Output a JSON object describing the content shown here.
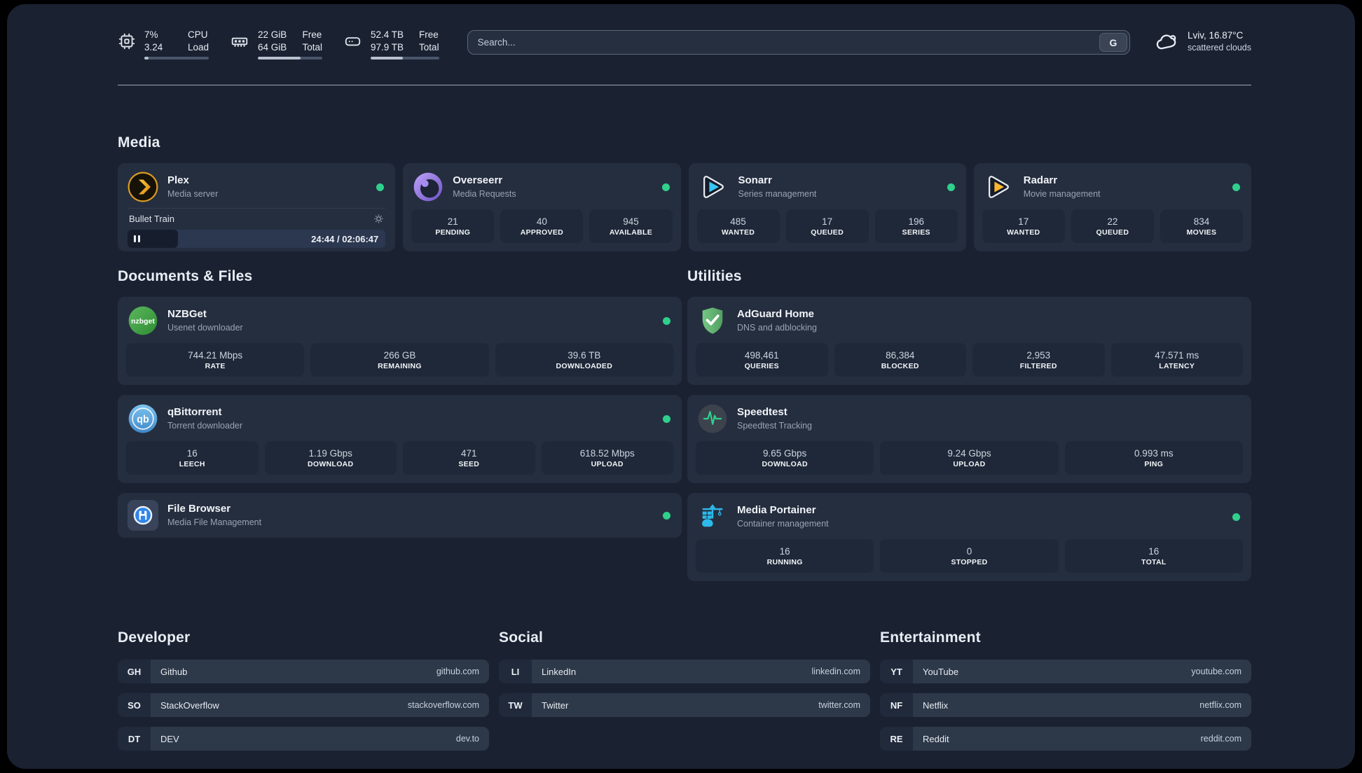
{
  "header": {
    "metrics": [
      {
        "name": "cpu",
        "line1": "7%",
        "line2": "3.24",
        "label1": "CPU",
        "label2": "Load",
        "progress": 7
      },
      {
        "name": "memory",
        "line1": "22 GiB",
        "line2": "64 GiB",
        "label1": "Free",
        "label2": "Total",
        "progress": 66
      },
      {
        "name": "storage",
        "line1": "52.4 TB",
        "line2": "97.9 TB",
        "label1": "Free",
        "label2": "Total",
        "progress": 47
      }
    ],
    "search": {
      "placeholder": "Search...",
      "provider_button": "G"
    },
    "weather": {
      "headline": "Lviv, 16.87°C",
      "condition": "scattered clouds"
    }
  },
  "sections": {
    "media": "Media",
    "documents": "Documents & Files",
    "utilities": "Utilities"
  },
  "apps": {
    "plex": {
      "name": "Plex",
      "desc": "Media server",
      "online": true,
      "player": {
        "title": "Bullet Train",
        "time": "24:44 / 02:06:47",
        "progress_pct": 19.5
      }
    },
    "overseerr": {
      "name": "Overseerr",
      "desc": "Media Requests",
      "online": true,
      "stats": [
        {
          "value": "21",
          "label": "PENDING"
        },
        {
          "value": "40",
          "label": "APPROVED"
        },
        {
          "value": "945",
          "label": "AVAILABLE"
        }
      ]
    },
    "sonarr": {
      "name": "Sonarr",
      "desc": "Series management",
      "online": true,
      "stats": [
        {
          "value": "485",
          "label": "WANTED"
        },
        {
          "value": "17",
          "label": "QUEUED"
        },
        {
          "value": "196",
          "label": "SERIES"
        }
      ]
    },
    "radarr": {
      "name": "Radarr",
      "desc": "Movie management",
      "online": true,
      "stats": [
        {
          "value": "17",
          "label": "WANTED"
        },
        {
          "value": "22",
          "label": "QUEUED"
        },
        {
          "value": "834",
          "label": "MOVIES"
        }
      ]
    },
    "nzbget": {
      "name": "NZBGet",
      "desc": "Usenet downloader",
      "online": true,
      "stats": [
        {
          "value": "744.21 Mbps",
          "label": "RATE"
        },
        {
          "value": "266 GB",
          "label": "REMAINING"
        },
        {
          "value": "39.6 TB",
          "label": "DOWNLOADED"
        }
      ]
    },
    "qbittorrent": {
      "name": "qBittorrent",
      "desc": "Torrent downloader",
      "online": true,
      "stats": [
        {
          "value": "16",
          "label": "LEECH"
        },
        {
          "value": "1.19 Gbps",
          "label": "DOWNLOAD"
        },
        {
          "value": "471",
          "label": "SEED"
        },
        {
          "value": "618.52 Mbps",
          "label": "UPLOAD"
        }
      ]
    },
    "filebrowser": {
      "name": "File Browser",
      "desc": "Media File Management",
      "online": true
    },
    "adguard": {
      "name": "AdGuard Home",
      "desc": "DNS and adblocking",
      "online": false,
      "stats": [
        {
          "value": "498,461",
          "label": "QUERIES"
        },
        {
          "value": "86,384",
          "label": "BLOCKED"
        },
        {
          "value": "2,953",
          "label": "FILTERED"
        },
        {
          "value": "47.571 ms",
          "label": "LATENCY"
        }
      ]
    },
    "speedtest": {
      "name": "Speedtest",
      "desc": "Speedtest Tracking",
      "online": false,
      "stats": [
        {
          "value": "9.65 Gbps",
          "label": "DOWNLOAD"
        },
        {
          "value": "9.24 Gbps",
          "label": "UPLOAD"
        },
        {
          "value": "0.993 ms",
          "label": "PING"
        }
      ]
    },
    "portainer": {
      "name": "Media Portainer",
      "desc": "Container management",
      "online": true,
      "stats": [
        {
          "value": "16",
          "label": "RUNNING"
        },
        {
          "value": "0",
          "label": "STOPPED"
        },
        {
          "value": "16",
          "label": "TOTAL"
        }
      ]
    }
  },
  "bookmarks": [
    {
      "title": "Developer",
      "items": [
        {
          "abbr": "GH",
          "name": "Github",
          "url": "github.com"
        },
        {
          "abbr": "SO",
          "name": "StackOverflow",
          "url": "stackoverflow.com"
        },
        {
          "abbr": "DT",
          "name": "DEV",
          "url": "dev.to"
        }
      ]
    },
    {
      "title": "Social",
      "items": [
        {
          "abbr": "LI",
          "name": "LinkedIn",
          "url": "linkedin.com"
        },
        {
          "abbr": "TW",
          "name": "Twitter",
          "url": "twitter.com"
        }
      ]
    },
    {
      "title": "Entertainment",
      "items": [
        {
          "abbr": "YT",
          "name": "YouTube",
          "url": "youtube.com"
        },
        {
          "abbr": "NF",
          "name": "Netflix",
          "url": "netflix.com"
        },
        {
          "abbr": "RE",
          "name": "Reddit",
          "url": "reddit.com"
        }
      ]
    }
  ],
  "colors": {
    "status_online": "#2fd08c",
    "plex_amber": "#e5a00d",
    "sonarr_blue": "#38c6f4",
    "radarr_amber": "#f9b630",
    "nzbget_green": "#3f9e3f",
    "qbittorrent_blue": "#4f9bd9",
    "adguard_green": "#67b279",
    "portainer_blue": "#2db9ea"
  }
}
